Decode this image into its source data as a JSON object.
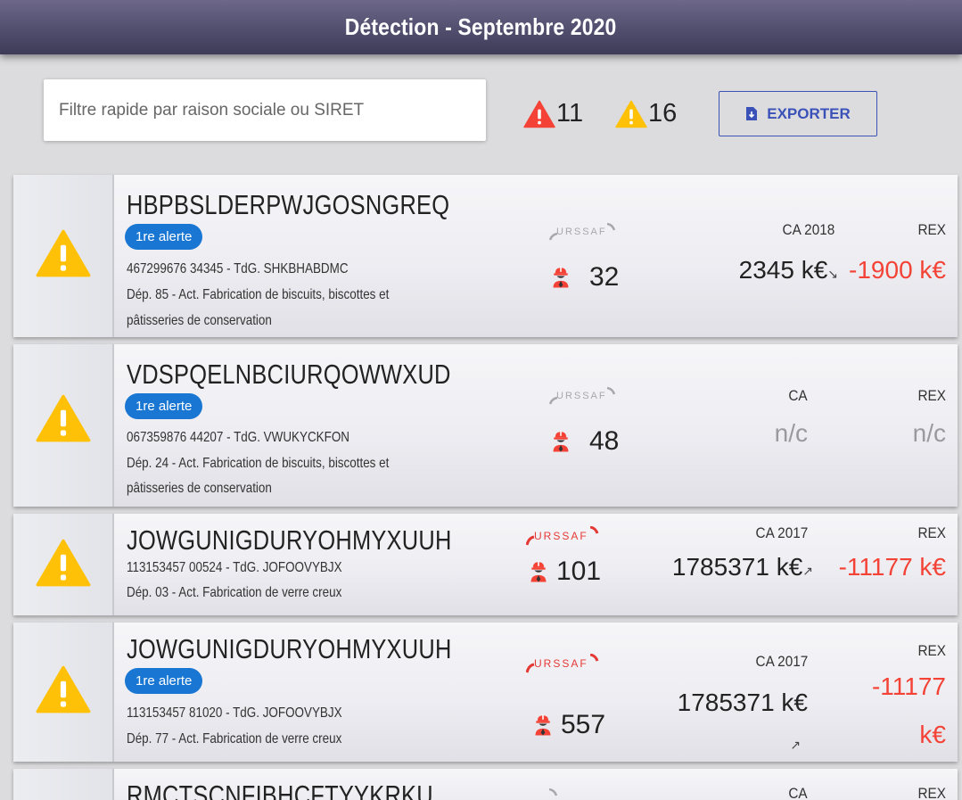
{
  "header": {
    "title": "Détection - Septembre 2020"
  },
  "filter": {
    "placeholder": "Filtre rapide par raison sociale ou SIRET",
    "red_count": "11",
    "yellow_count": "16",
    "export_label": "EXPORTER"
  },
  "colors": {
    "red_alert": "#f44336",
    "yellow_alert": "#ffc107",
    "badge_blue": "#1976d2",
    "export_blue": "#3a52b8"
  },
  "icons": {
    "alert_red": "warning-triangle-icon",
    "alert_yellow": "warning-triangle-icon",
    "export": "file-download-icon",
    "workers": "worker-icon",
    "urssaf": "urssaf-logo",
    "trend_down": "arrow-down-right",
    "trend_up": "arrow-up-right"
  },
  "cards": [
    {
      "name": "HBPBSLDERPWJGOSNGREQ",
      "badge": "1re alerte",
      "siret_line": "467299676 34345 - TdG. SHKBHABDMC",
      "activity_line1": "Dép. 85 - Act. Fabrication de biscuits, biscottes et",
      "activity_line2": "pâtisseries de conservation",
      "urssaf": "URSSAF",
      "urssaf_active": false,
      "workers": "32",
      "ca_label": "CA 2018",
      "ca_value": "2345 k€",
      "ca_trend": "↘",
      "rex_label": "REX",
      "rex_value": "-1900 k€"
    },
    {
      "name": "VDSPQELNBCIURQOWWXUD",
      "badge": "1re alerte",
      "siret_line": "067359876 44207 - TdG. VWUKYCKFON",
      "activity_line1": "Dép. 24 - Act. Fabrication de biscuits, biscottes et",
      "activity_line2": "pâtisseries de conservation",
      "urssaf": "URSSAF",
      "urssaf_active": false,
      "workers": "48",
      "ca_label": "CA",
      "ca_value": "n/c",
      "rex_label": "REX",
      "rex_value": "n/c"
    },
    {
      "name": "JOWGUNIGDURYOHMYXUUH",
      "siret_line": "113153457 00524 - TdG. JOFOOVYBJX",
      "activity_line1": "Dép. 03 - Act. Fabrication de verre creux",
      "urssaf": "URSSAF",
      "urssaf_active": true,
      "workers": "101",
      "ca_label": "CA 2017",
      "ca_value": "1785371 k€",
      "ca_trend": "↗",
      "rex_label": "REX",
      "rex_value": "-11177 k€"
    },
    {
      "name": "JOWGUNIGDURYOHMYXUUH",
      "badge": "1re alerte",
      "siret_line": "113153457 81020 - TdG. JOFOOVYBJX",
      "activity_line1": "Dép. 77 - Act. Fabrication de verre creux",
      "urssaf": "URSSAF",
      "urssaf_active": true,
      "workers": "557",
      "ca_label": "CA 2017",
      "ca_value": "1785371 k€",
      "ca_trend": "↗",
      "rex_label": "REX",
      "rex_value_line1": "-11177",
      "rex_value_line2": "k€"
    },
    {
      "name": "RMCTSCNFIBHCFTYYKRKU",
      "ca_label": "CA",
      "rex_label": "REX"
    }
  ]
}
